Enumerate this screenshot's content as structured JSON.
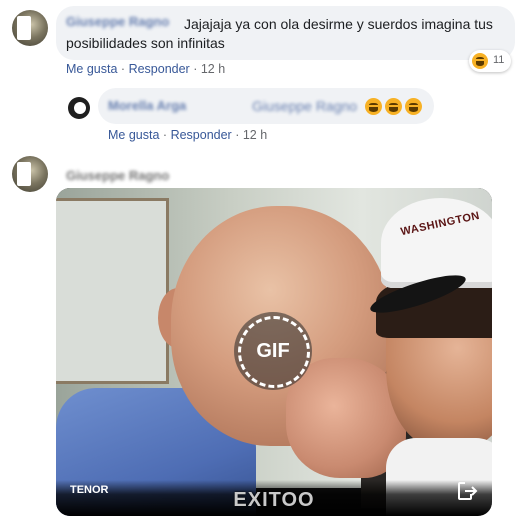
{
  "comment1": {
    "author": "Giuseppe Ragno",
    "text": "Jajajaja ya con ola desirme y suerdos imagina tus posibilidades son infinitas",
    "like": "Me gusta",
    "reply": "Responder",
    "sep": "·",
    "time": "12 h",
    "reaction_count": "11"
  },
  "reply1": {
    "author": "Morella Arga",
    "mention": "Giuseppe Ragno",
    "like": "Me gusta",
    "reply": "Responder",
    "sep": "·",
    "time": "12 h"
  },
  "comment2": {
    "author": "Giuseppe Ragno"
  },
  "gif": {
    "badge": "GIF",
    "provider": "TENOR",
    "caption": "EXITOO",
    "cap_text": "WASHINGTON"
  },
  "icons": {
    "reaction": "laughing-emoji-icon",
    "share": "share-external-icon"
  }
}
